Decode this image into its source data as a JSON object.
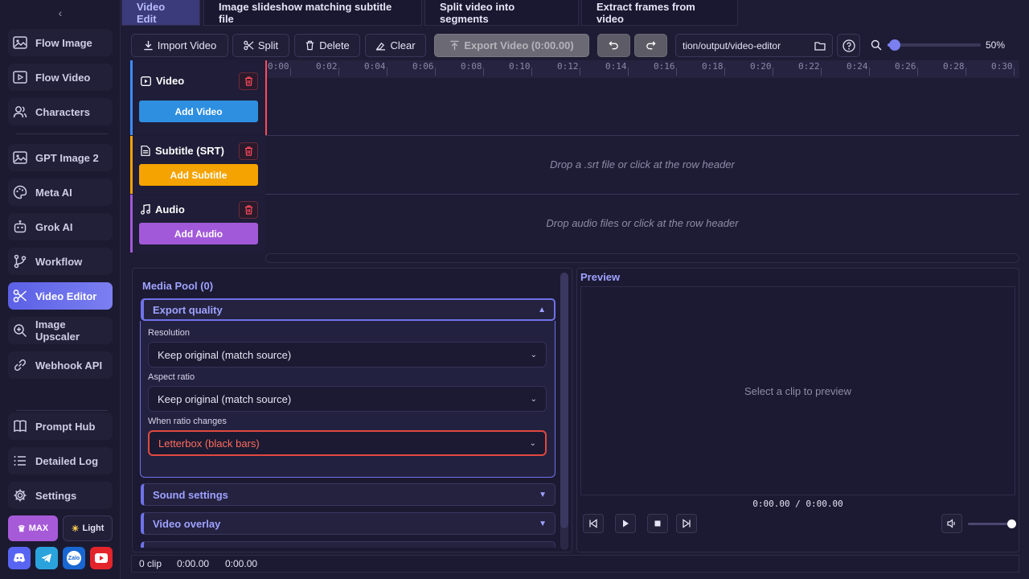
{
  "sidebar": {
    "items": [
      {
        "label": "Flow Image",
        "icon": "image-icon"
      },
      {
        "label": "Flow Video",
        "icon": "video-icon"
      },
      {
        "label": "Characters",
        "icon": "users-icon"
      },
      {
        "label": "GPT Image 2",
        "icon": "image-icon"
      },
      {
        "label": "Meta AI",
        "icon": "palette-icon"
      },
      {
        "label": "Grok AI",
        "icon": "bot-icon"
      },
      {
        "label": "Workflow",
        "icon": "git-branch-icon"
      },
      {
        "label": "Video Editor",
        "icon": "scissors-icon",
        "active": true
      },
      {
        "label": "Image Upscaler",
        "icon": "zoom-in-icon"
      },
      {
        "label": "Webhook API",
        "icon": "link-icon"
      },
      {
        "label": "Prompt Hub",
        "icon": "book-icon"
      },
      {
        "label": "Detailed Log",
        "icon": "list-icon"
      },
      {
        "label": "Settings",
        "icon": "gear-icon"
      }
    ],
    "max_badge": "MAX",
    "theme_label": "Light"
  },
  "tabs": [
    "Video Edit",
    "Image slideshow matching subtitle file",
    "Split video into segments",
    "Extract frames from video"
  ],
  "toolbar": {
    "import": "Import Video",
    "split": "Split",
    "delete": "Delete",
    "clear": "Clear",
    "export": "Export Video (0:00.00)",
    "path": "tion/output/video-editor",
    "zoom": "50%",
    "zoom_level": 0.08
  },
  "ruler": [
    "0:00",
    "0:02",
    "0:04",
    "0:06",
    "0:08",
    "0:10",
    "0:12",
    "0:14",
    "0:16",
    "0:18",
    "0:20",
    "0:22",
    "0:24",
    "0:26",
    "0:28",
    "0:30"
  ],
  "tracks": {
    "video": {
      "name": "Video",
      "button": "Add Video"
    },
    "subtitle": {
      "name": "Subtitle (SRT)",
      "button": "Add Subtitle",
      "hint": "Drop a .srt file or click at the row header"
    },
    "audio": {
      "name": "Audio",
      "button": "Add Audio",
      "hint": "Drop audio files or click at the row header"
    }
  },
  "media_pool": {
    "title": "Media Pool (0)",
    "export_quality": {
      "title": "Export quality",
      "resolution_label": "Resolution",
      "resolution_value": "Keep original (match source)",
      "aspect_label": "Aspect ratio",
      "aspect_value": "Keep original (match source)",
      "ratio_change_label": "When ratio changes",
      "ratio_change_value": "Letterbox (black bars)"
    },
    "sound_settings": "Sound settings",
    "video_overlay": "Video overlay"
  },
  "preview": {
    "title": "Preview",
    "placeholder": "Select a clip to preview",
    "time": "0:00.00 / 0:00.00",
    "volume": 1.0
  },
  "status": {
    "clips": "0 clip",
    "t1": "0:00.00",
    "t2": "0:00.00"
  }
}
